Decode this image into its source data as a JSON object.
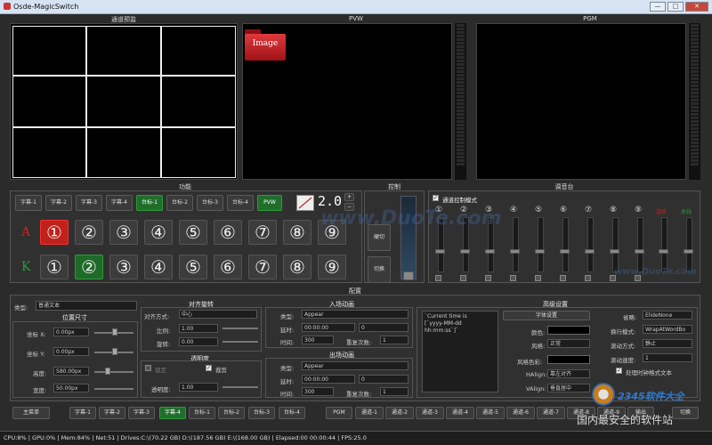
{
  "window": {
    "title": "Osde-MagicSwitch",
    "min": "—",
    "max": "□",
    "close": "✕"
  },
  "heads": {
    "multiview": "通道预监",
    "pvw": "PVW",
    "pgm": "PGM",
    "function": "功能",
    "control": "控制",
    "mixer": "调音台",
    "config": "配置"
  },
  "image_label": "Image",
  "func_buttons": [
    "字幕-1",
    "字幕-2",
    "字幕-3",
    "字幕-4",
    "台标-1",
    "台标-2",
    "台标-3",
    "台标-4",
    "PVW"
  ],
  "func_active": 4,
  "speed_value": "2.0",
  "row_a_letter": "A",
  "row_b_letter": "K",
  "row_a": [
    "①",
    "②",
    "③",
    "④",
    "⑤",
    "⑥",
    "⑦",
    "⑧",
    "⑨"
  ],
  "row_b": [
    "①",
    "②",
    "③",
    "④",
    "⑤",
    "⑥",
    "⑦",
    "⑧",
    "⑨"
  ],
  "row_a_active": 0,
  "row_b_active": 1,
  "control": {
    "cut": "硬切",
    "trans": "切换"
  },
  "mixer": {
    "check_label": "通道控制模式",
    "channels": [
      "①",
      "②",
      "③",
      "④",
      "⑤",
      "⑥",
      "⑦",
      "⑧",
      "⑨"
    ],
    "extra1": "监听",
    "extra2": "总线"
  },
  "config": {
    "type_label": "类型:",
    "type_value": "普通文本",
    "pos_title": "位置尺寸",
    "x_label": "坐标 X:",
    "x_val": "0.00px",
    "y_label": "坐标 Y:",
    "y_val": "0.00px",
    "h_label": "高度:",
    "h_val": "580.00px",
    "w_label": "宽度:",
    "w_val": "50.00px",
    "align_title": "对齐旋转",
    "align_label": "对齐方式:",
    "align_val": "中心",
    "scale_label": "比例:",
    "scale_val": "1.00",
    "rot_label": "旋转:",
    "rot_val": "0.00",
    "opacity_title": "透明度",
    "lock_label": "锁定",
    "crop_label": "裁剪",
    "opacity_label": "透明度:",
    "opacity_val": "1.00",
    "in_title": "入场动画",
    "in_type_label": "类型:",
    "in_type": "Appear",
    "in_delay_label": "延时:",
    "in_delay": "00:00:00",
    "in_delay2": "0",
    "in_time_label": "时间:",
    "in_time": "300",
    "in_rep_label": "重复次数:",
    "in_rep": "1",
    "out_title": "出场动画",
    "out_type_label": "类型:",
    "out_type": "Appear",
    "out_delay_label": "延时:",
    "out_delay": "00:00:00",
    "out_delay2": "0",
    "out_time_label": "时间:",
    "out_time": "300",
    "out_rep_label": "重复次数:",
    "out_rep": "1",
    "adv_title": "高级设置",
    "text_content": "`Current time is\n[`yyyy-MM-dd\nhh:mm:ss`]`",
    "font_btn": "字体设置",
    "color_label": "颜色:",
    "style_label": "风格:",
    "style_val": "正常",
    "stylecolor_label": "风格色彩:",
    "halign_label": "HAlign:",
    "halign_val": "靠左对齐",
    "valign_label": "VAlign:",
    "valign_val": "垂直居中",
    "omit_label": "省略:",
    "omit_val": "ElideNone",
    "wrap_label": "换行模式:",
    "wrap_val": "WrapAtWordBo",
    "scroll_label": "滚动方式:",
    "scroll_val": "静止",
    "speed_label": "滚动速度:",
    "speed_val": "1",
    "fmt_label": "处理时钟格式文本"
  },
  "bottom": {
    "menu": "主菜单",
    "subs": [
      "字幕-1",
      "字幕-2",
      "字幕-3",
      "字幕-4",
      "台标-1",
      "台标-2",
      "台标-3",
      "台标-4"
    ],
    "pgm": "PGM",
    "channels": [
      "通道-1",
      "通道-2",
      "通道-3",
      "通道-4",
      "通道-5",
      "通道-6",
      "通道-7",
      "通道-8",
      "通道-9"
    ],
    "extra1": "输出",
    "extra2": "切换"
  },
  "status": "CPU:8% | GPU:0% | Mem:84% | Net:51 | Drives:C:\\(70.22 GB)  D:\\(187.56 GB)  E:\\(168.00 GB) | Elapsed:00 00:00:44 | FPS:25.0",
  "watermarks": {
    "duote": "www.DuoTe.com",
    "duote2": "www.DuoTe.com",
    "brand": "2345软件大全",
    "tagline": "国内最安全的软件站"
  },
  "colors": {
    "red": "#c0211a",
    "green": "#1e6a27",
    "pvw_bg": "#000"
  }
}
